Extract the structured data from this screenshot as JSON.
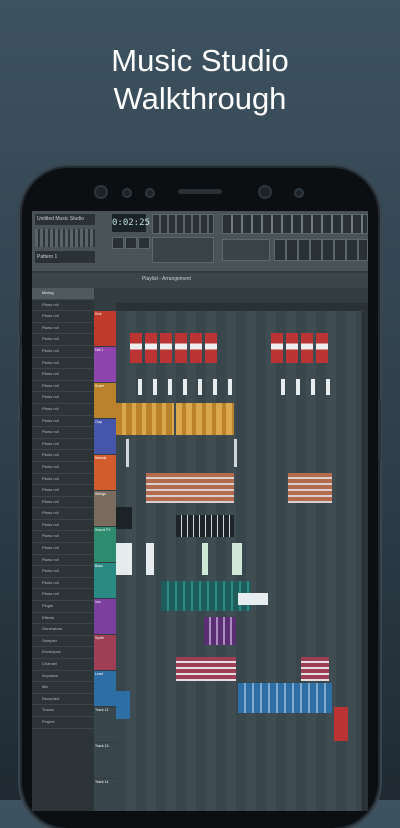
{
  "headline": {
    "line1": "Music Studio",
    "line2": "Walkthrough"
  },
  "app": {
    "toolbar_title": "Untitled Music Studio",
    "pattern_label": "Pattern 1",
    "time_display": "0:02:25",
    "playlist_title": "Playlist - Arrangement"
  },
  "left_panel": {
    "items": [
      "Mixing",
      "Piano roll",
      "Piano roll",
      "Piano roll",
      "Piano roll",
      "Piano roll",
      "Piano roll",
      "Piano roll",
      "Piano roll",
      "Piano roll",
      "Piano roll",
      "Piano roll",
      "Piano roll",
      "Piano roll",
      "Piano roll",
      "Piano roll",
      "Piano roll",
      "Piano roll",
      "Piano roll",
      "Piano roll",
      "Piano roll",
      "Piano roll",
      "Piano roll",
      "Piano roll",
      "Piano roll",
      "Piano roll",
      "Piano roll",
      "Plugin",
      "Effects",
      "Generators",
      "Sampler",
      "Envelopes",
      "Channel",
      "Impulses",
      "Mix",
      "Recorded",
      "Tracks",
      "Project"
    ]
  },
  "tracks": [
    {
      "label": "Kick",
      "color": "#c0392b"
    },
    {
      "label": "Hat 1",
      "color": "#8e44ad"
    },
    {
      "label": "Snare",
      "color": "#b9822b"
    },
    {
      "label": "Clap",
      "color": "#4455aa"
    },
    {
      "label": "Melody",
      "color": "#d35c2c"
    },
    {
      "label": "Strings",
      "color": "#7a6b5f"
    },
    {
      "label": "Sound FX",
      "color": "#2c8c6d"
    },
    {
      "label": "Bass",
      "color": "#2a8a84"
    },
    {
      "label": "Vox",
      "color": "#7b3f9e"
    },
    {
      "label": "Synth",
      "color": "#9e3f55"
    },
    {
      "label": "Lead",
      "color": "#2d6fa5"
    },
    {
      "label": "Track 12",
      "color": "#39464b"
    },
    {
      "label": "Track 13",
      "color": "#39464b"
    },
    {
      "label": "Track 14",
      "color": "#39464b"
    }
  ]
}
